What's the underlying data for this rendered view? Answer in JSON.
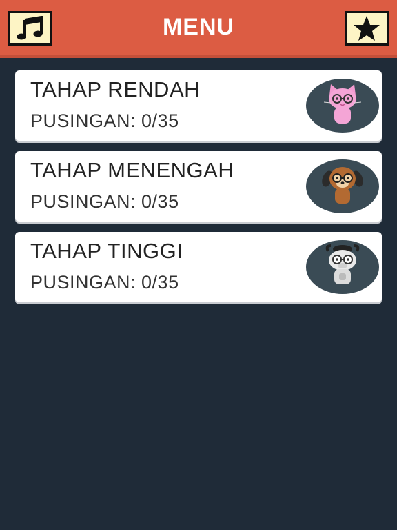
{
  "header": {
    "title": "MENU",
    "music_button_icon": "music-note-icon",
    "favorites_button_icon": "star-icon",
    "bar_color": "#dc5c43"
  },
  "levels": [
    {
      "label": "TAHAP RENDAH",
      "progress_label": "PUSINGAN:",
      "progress_value": "0/35",
      "avatar": "cat-with-glasses"
    },
    {
      "label": "TAHAP MENENGAH",
      "progress_label": "PUSINGAN:",
      "progress_value": "0/35",
      "avatar": "dog-with-glasses"
    },
    {
      "label": "TAHAP TINGGI",
      "progress_label": "PUSINGAN:",
      "progress_value": "0/35",
      "avatar": "cow-with-glasses"
    }
  ],
  "colors": {
    "background": "#1f2b38",
    "card": "#ffffff",
    "avatar_bg": "#3a4b55"
  }
}
